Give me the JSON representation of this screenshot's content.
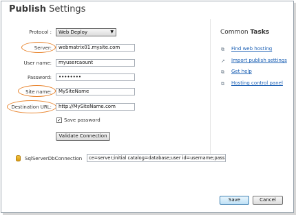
{
  "window": {
    "title_bold": "Publish",
    "title_rest": " Settings"
  },
  "form": {
    "protocol_label": "Protocol :",
    "protocol_value": "Web Deploy",
    "server_label": "Server:",
    "server_value": "webmatrix01.mysite.com",
    "username_label": "User name:",
    "username_value": "myusercaount",
    "password_label": "Password:",
    "password_value": "••••••••",
    "sitename_label": "Site name:",
    "sitename_value": "MySiteName",
    "desturl_label": "Destination URL:",
    "desturl_value": "http://MySiteName.com",
    "save_password_label": "Save password",
    "save_password_checked": true,
    "validate_button": "Validate Connection"
  },
  "database": {
    "name": "SqlServerDbConnection",
    "connection_string": "ce=server;initial catalog=database;user id=username;password="
  },
  "tasks": {
    "title_plain": "Common ",
    "title_bold": "Tasks",
    "items": [
      {
        "label": "Find web hosting",
        "icon": "external-link-icon"
      },
      {
        "label": "Import publish settings",
        "icon": "import-icon"
      },
      {
        "label": "Get help",
        "icon": "external-link-icon"
      },
      {
        "label": "Hosting control panel",
        "icon": "external-link-icon"
      }
    ]
  },
  "footer": {
    "save_button": "Save",
    "cancel_button": "Cancel"
  },
  "colors": {
    "highlight_ellipse": "#e8822a",
    "link": "#1a5fb4"
  }
}
